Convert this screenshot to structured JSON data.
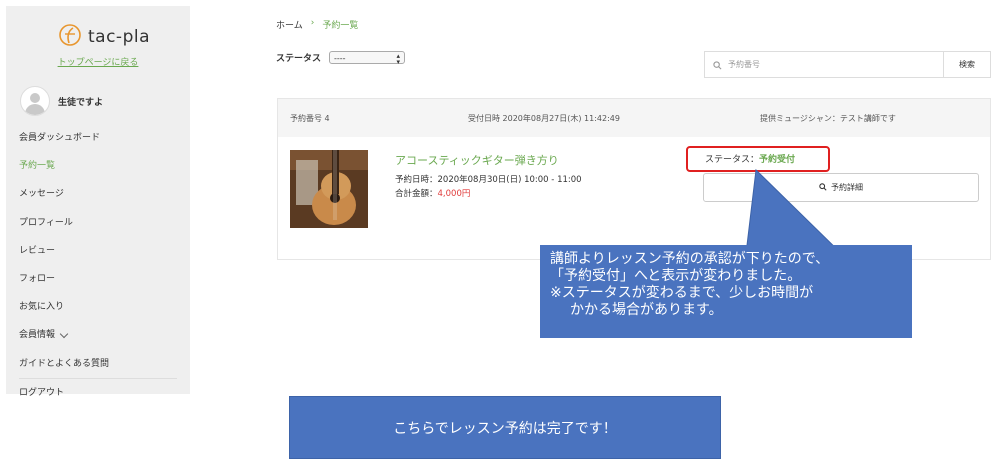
{
  "sidebar": {
    "logo_text": "tac-pla",
    "top_link": "トップページに戻る",
    "user_name": "生徒ですよ",
    "items": [
      {
        "label": "会員ダッシュボード"
      },
      {
        "label": "予約一覧"
      },
      {
        "label": "メッセージ"
      },
      {
        "label": "プロフィール"
      },
      {
        "label": "レビュー"
      },
      {
        "label": "フォロー"
      },
      {
        "label": "お気に入り"
      },
      {
        "label": "会員情報"
      },
      {
        "label": "ガイドとよくある質問"
      },
      {
        "label": "ログアウト"
      }
    ],
    "active_item": "予約一覧"
  },
  "breadcrumb": {
    "home": "ホーム",
    "separator": "›",
    "current": "予約一覧"
  },
  "filter": {
    "status_label": "ステータス",
    "status_value": "----"
  },
  "search": {
    "placeholder": "予約番号",
    "button_label": "検索"
  },
  "reservation": {
    "number_label": "予約番号 4",
    "accepted_at": "受付日時 2020年08月27日(木) 11:42:49",
    "instructor": "提供ミュージシャン：テスト講師です",
    "lesson_title": "アコースティックギター弾き方り",
    "lesson_date": "予約日時：2020年08月30日(日) 10:00 - 11:00",
    "total_label": "合計金額：",
    "total_price": "4,000円",
    "status_label": "ステータス：",
    "status_value": "予約受付",
    "detail_button": "予約詳細"
  },
  "callout": {
    "line1": "講師よりレッスン予約の承認が下りたので、",
    "line2": "「予約受付」へと表示が変わりました。",
    "line3": "※ステータスが変わるまで、少しお時間が",
    "line4": "かかる場合があります。"
  },
  "banner": {
    "text": "こちらでレッスン予約は完了です！"
  },
  "colors": {
    "accent_green": "#6aa84f",
    "price_red": "#e03b3b",
    "highlight_red": "#e02020",
    "callout_blue": "#4a73bf",
    "sidebar_bg": "#efefef"
  }
}
